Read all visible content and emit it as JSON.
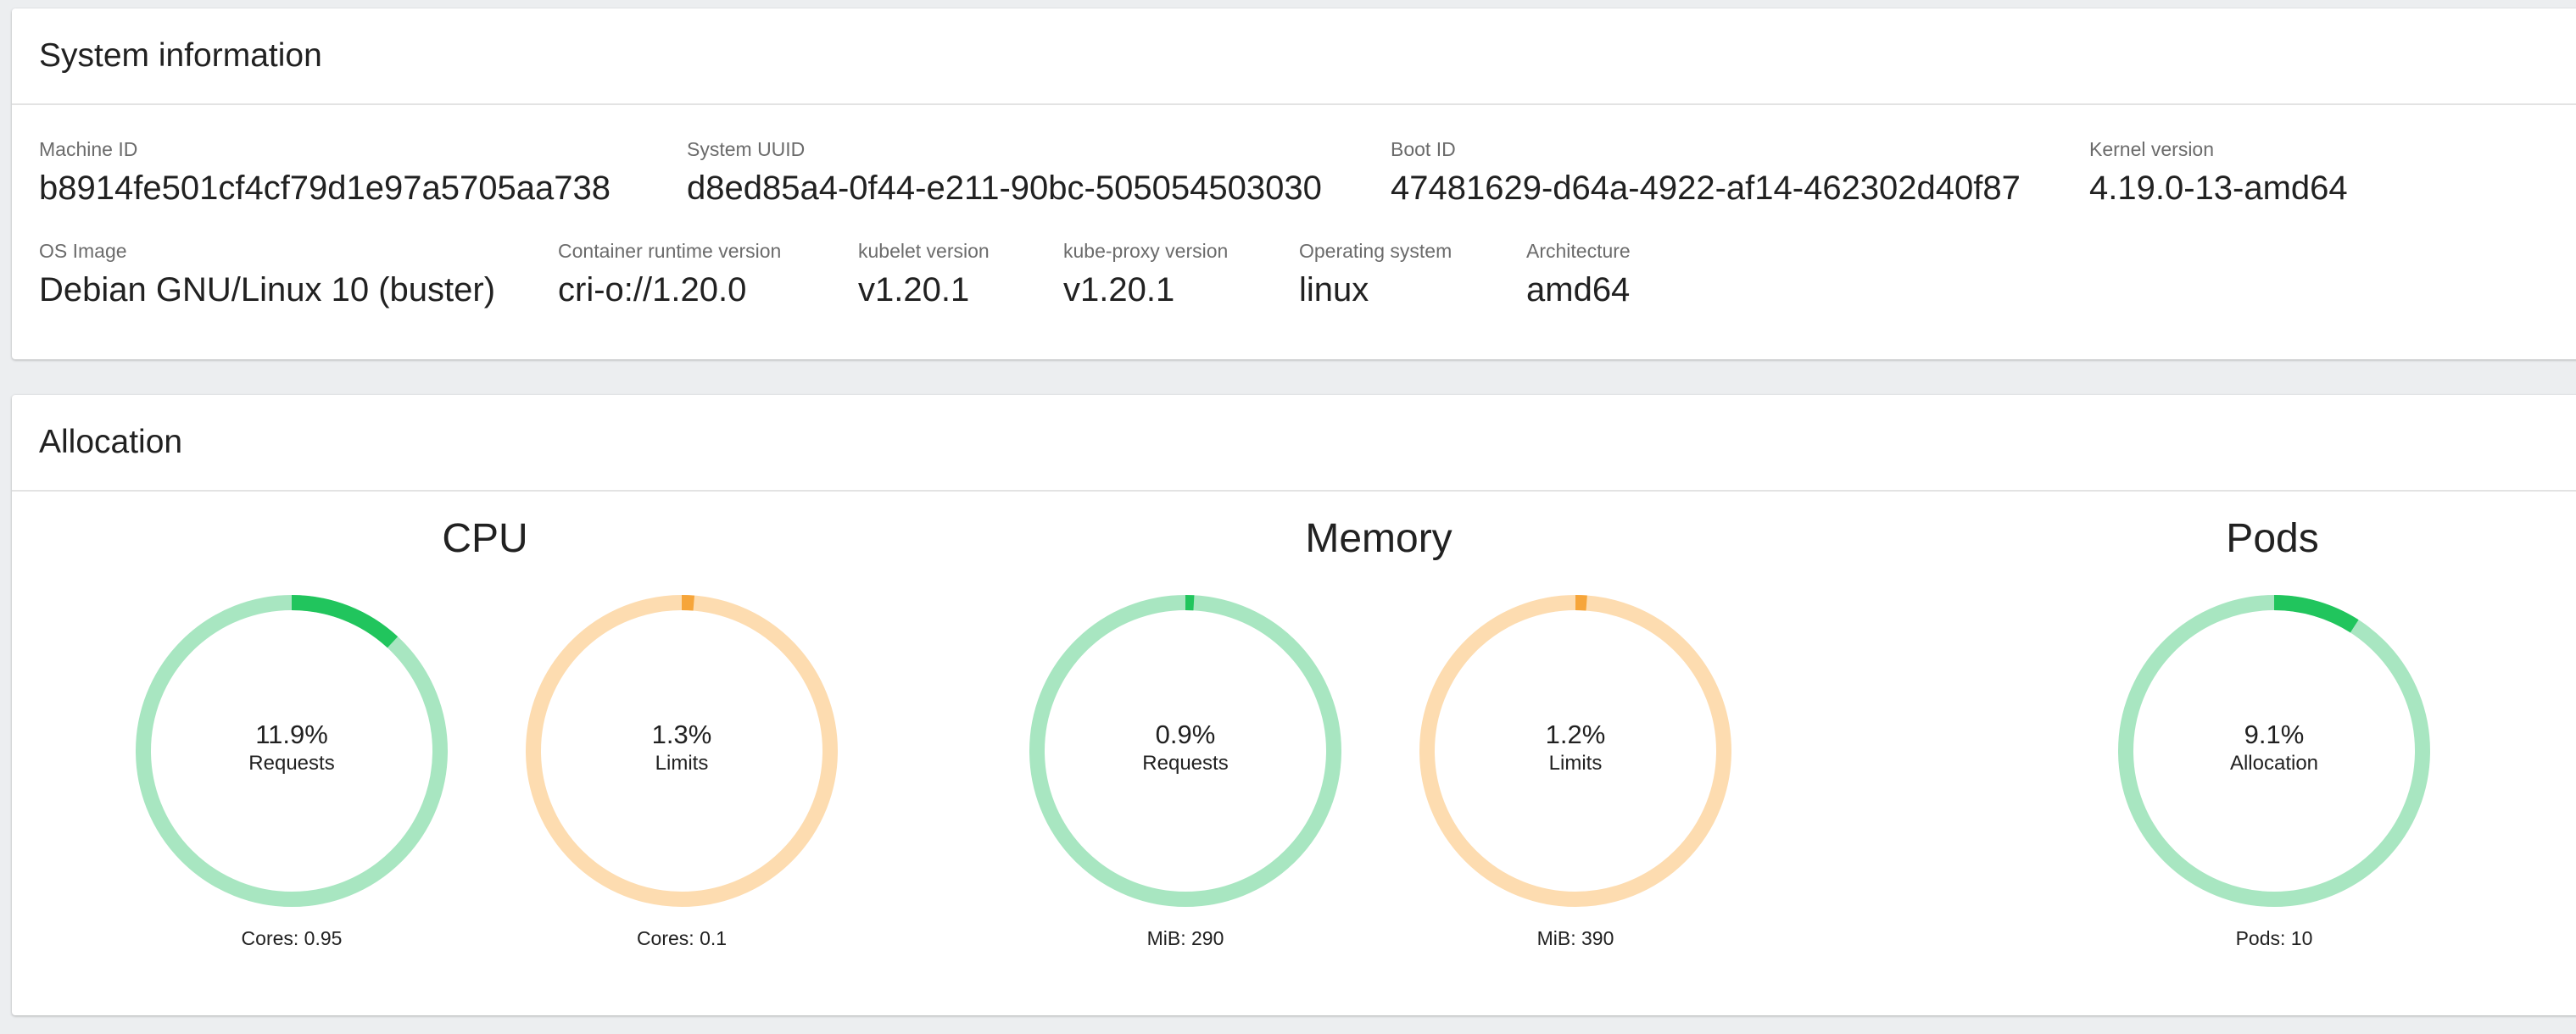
{
  "system_info": {
    "title": "System information",
    "fields": [
      {
        "label": "Machine ID",
        "value": "b8914fe501cf4cf79d1e97a5705aa738"
      },
      {
        "label": "System UUID",
        "value": "d8ed85a4-0f44-e211-90bc-505054503030"
      },
      {
        "label": "Boot ID",
        "value": "47481629-d64a-4922-af14-462302d40f87"
      },
      {
        "label": "Kernel version",
        "value": "4.19.0-13-amd64"
      },
      {
        "label": "OS Image",
        "value": "Debian GNU/Linux 10 (buster)"
      },
      {
        "label": "Container runtime version",
        "value": "cri-o://1.20.0"
      },
      {
        "label": "kubelet version",
        "value": "v1.20.1"
      },
      {
        "label": "kube-proxy version",
        "value": "v1.20.1"
      },
      {
        "label": "Operating system",
        "value": "linux"
      },
      {
        "label": "Architecture",
        "value": "amd64"
      }
    ]
  },
  "allocation": {
    "title": "Allocation",
    "sections": [
      {
        "title": "CPU",
        "gauges": [
          {
            "percent_text": "11.9%",
            "fraction": 0.119,
            "label": "Requests",
            "caption": "Cores: 0.95",
            "kind": "requests"
          },
          {
            "percent_text": "1.3%",
            "fraction": 0.013,
            "label": "Limits",
            "caption": "Cores: 0.1",
            "kind": "limits"
          }
        ]
      },
      {
        "title": "Memory",
        "gauges": [
          {
            "percent_text": "0.9%",
            "fraction": 0.009,
            "label": "Requests",
            "caption": "MiB: 290",
            "kind": "requests"
          },
          {
            "percent_text": "1.2%",
            "fraction": 0.012,
            "label": "Limits",
            "caption": "MiB: 390",
            "kind": "limits"
          }
        ]
      },
      {
        "title": "Pods",
        "gauges": [
          {
            "percent_text": "9.1%",
            "fraction": 0.091,
            "label": "Allocation",
            "caption": "Pods: 10",
            "kind": "requests"
          }
        ]
      }
    ]
  },
  "colors": {
    "requests_track": "#a8e6c1",
    "requests_fill": "#21c55d",
    "limits_track": "#fddcb0",
    "limits_fill": "#f6a53a"
  }
}
